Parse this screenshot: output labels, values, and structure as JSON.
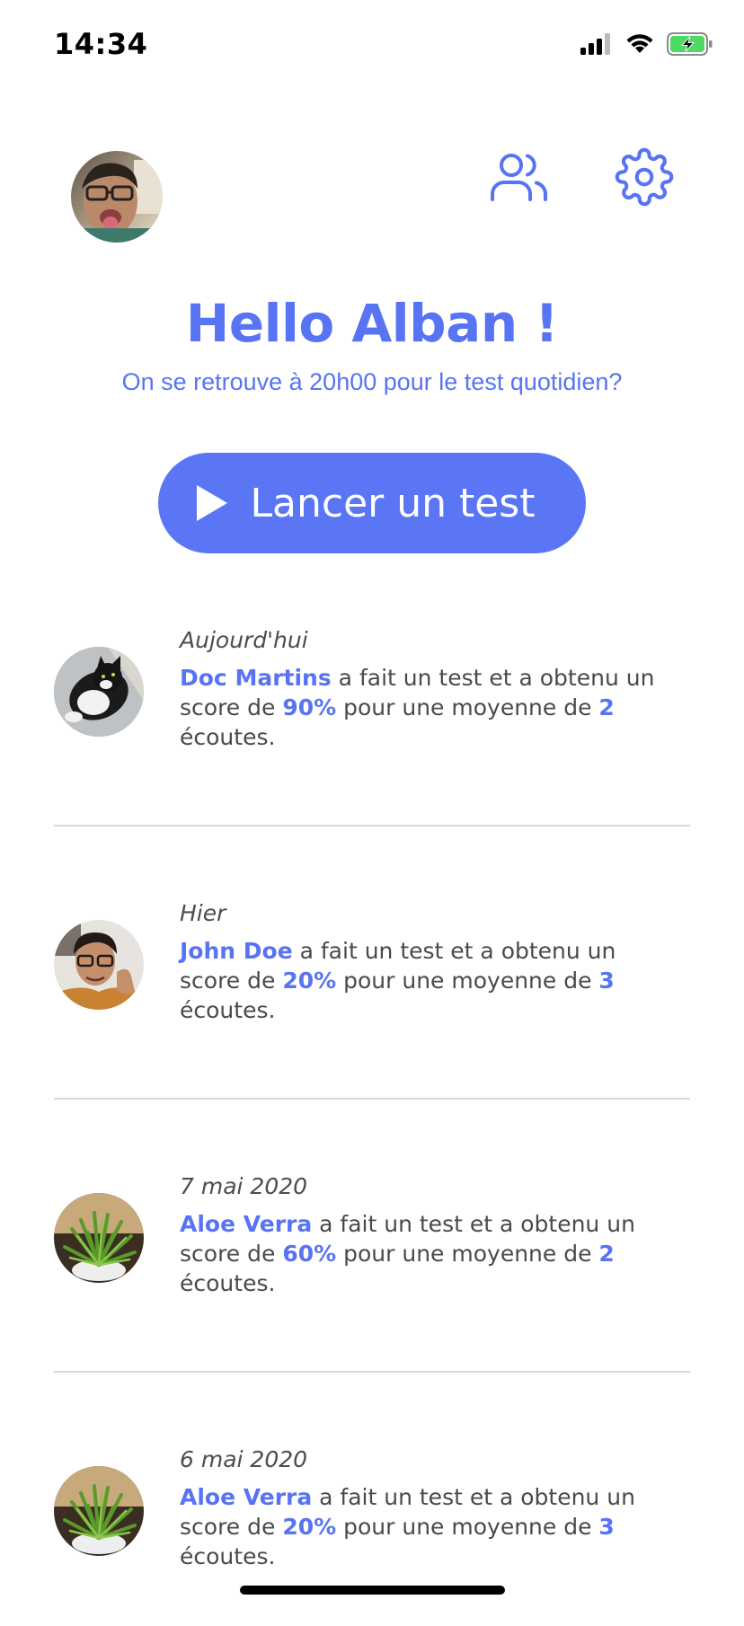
{
  "status_bar": {
    "time": "14:34",
    "icons": [
      "cellular-signal-icon",
      "wifi-icon",
      "battery-charging-icon"
    ]
  },
  "header": {
    "avatar": "user-avatar",
    "friends_icon": "users-icon",
    "settings_icon": "gear-icon"
  },
  "greeting": {
    "title": "Hello Alban !",
    "subtitle": "On se retrouve à 20h00 pour le test quotidien?"
  },
  "start_button": {
    "label": "Lancer un test",
    "icon": "play-icon"
  },
  "feed": [
    {
      "date": "Aujourd'hui",
      "name": "Doc Martins",
      "text_before": " a fait un test et a obtenu un score de ",
      "score": "90%",
      "text_middle": " pour une moyenne de ",
      "listens": "2",
      "text_after": " écoutes."
    },
    {
      "date": "Hier",
      "name": "John Doe",
      "text_before": " a fait un test et a obtenu un score de ",
      "score": "20%",
      "text_middle": " pour une moyenne de ",
      "listens": "3",
      "text_after": " écoutes."
    },
    {
      "date": "7 mai 2020",
      "name": "Aloe Verra",
      "text_before": " a fait un test et a obtenu un score de ",
      "score": "60%",
      "text_middle": " pour une moyenne de ",
      "listens": "2",
      "text_after": " écoutes."
    },
    {
      "date": "6 mai 2020",
      "name": "Aloe Verra",
      "text_before": " a fait un test et a obtenu un score de ",
      "score": "20%",
      "text_middle": " pour une moyenne de ",
      "listens": "3",
      "text_after": " écoutes."
    }
  ],
  "colors": {
    "accent": "#5874f2",
    "button": "#5b76f5",
    "text": "#4a4a4a",
    "divider": "#d9d9d9"
  }
}
